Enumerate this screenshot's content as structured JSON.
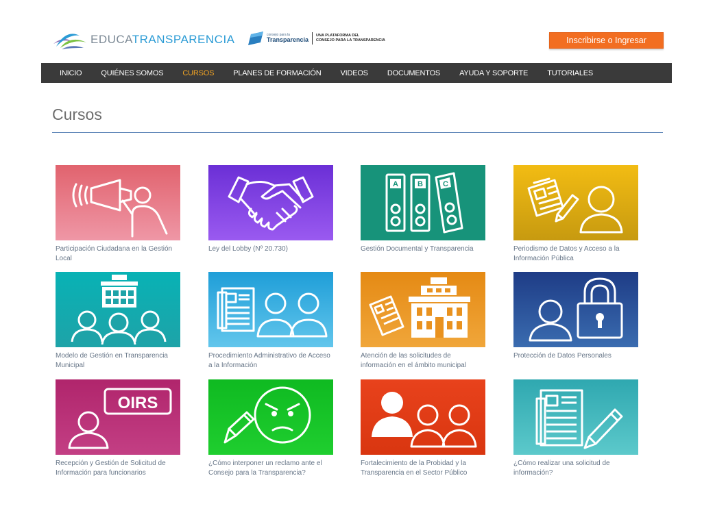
{
  "brand": {
    "name_light": "EDUCA",
    "name_bold": "TRANSPARENCIA",
    "partner_small": "consejo para la",
    "partner_name": "Transparencia",
    "partner_tag_1": "UNA PLATAFORMA DEL",
    "partner_tag_2": "CONSEJO PARA LA TRANSPARENCIA"
  },
  "header": {
    "login_label": "Inscribirse o Ingresar"
  },
  "nav": {
    "items": [
      "INICIO",
      "QUIÉNES SOMOS",
      "CURSOS",
      "PLANES DE FORMACIÓN",
      "VIDEOS",
      "DOCUMENTOS",
      "AYUDA Y SOPORTE",
      "TUTORIALES"
    ],
    "active": "CURSOS"
  },
  "page": {
    "title": "Cursos"
  },
  "courses": [
    {
      "title": "Participación Ciudadana en la Gestión Local",
      "icon": "megaphone-person-icon"
    },
    {
      "title": "Ley del Lobby (Nº 20.730)",
      "icon": "handshake-icon"
    },
    {
      "title": "Gestión Documental y Transparencia",
      "icon": "binders-icon",
      "binder_letters": [
        "A",
        "B",
        "C"
      ]
    },
    {
      "title": "Periodismo de Datos y Acceso a la Información Pública",
      "icon": "newspaper-person-icon"
    },
    {
      "title": "Modelo de Gestión en Transparencia Municipal",
      "icon": "building-people-icon"
    },
    {
      "title": "Procedimiento Administrativo de Acceso a la Información",
      "icon": "document-people-icon"
    },
    {
      "title": "Atención de las solicitudes de información en el ámbito municipal",
      "icon": "newspaper-building-icon"
    },
    {
      "title": "Protección de Datos Personales",
      "icon": "person-padlock-icon"
    },
    {
      "title": "Recepción y Gestión de Solicitud de Información para funcionarios",
      "icon": "oirs-person-icon",
      "sign_text": "OIRS"
    },
    {
      "title": "¿Cómo interponer un reclamo ante el Consejo para la Transparencia?",
      "icon": "angry-face-pencil-icon"
    },
    {
      "title": "Fortalecimiento de la Probidad y la Transparencia en el Sector Público",
      "icon": "three-people-icon"
    },
    {
      "title": "¿Cómo realizar una solicitud de información?",
      "icon": "document-pencil-icon"
    }
  ],
  "colors": {
    "accent_orange": "#f26e21",
    "nav_background": "#3a3a3a",
    "nav_active": "#f5a623",
    "brand_blue": "#2a9bd5"
  }
}
